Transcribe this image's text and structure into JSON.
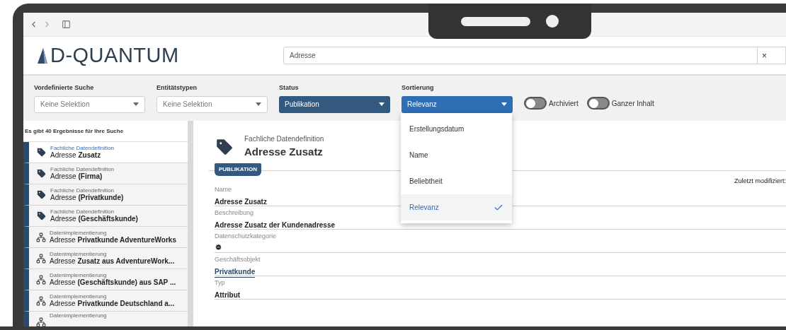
{
  "header": {
    "logo": "D-QUANTUM",
    "search": {
      "value": "Adresse"
    },
    "clear": "×"
  },
  "filters": [
    {
      "label": "Vordefinierte Suche",
      "placeholder": "Keine Selektion",
      "kind": "plain"
    },
    {
      "label": "Entitätstypen",
      "placeholder": "Keine Selektion",
      "kind": "plain"
    },
    {
      "label": "Status",
      "value": "Publikation",
      "kind": "filled"
    },
    {
      "label": "Sortierung",
      "value": "Relevanz",
      "kind": "open"
    }
  ],
  "toggles": [
    {
      "label": "Archiviert",
      "on": false
    },
    {
      "label": "Ganzer Inhalt",
      "on": false
    }
  ],
  "sort_menu": [
    {
      "label": "Erstellungsdatum",
      "selected": false
    },
    {
      "label": "Name",
      "selected": false
    },
    {
      "label": "Beliebtheit",
      "selected": false
    },
    {
      "label": "Relevanz",
      "selected": true
    }
  ],
  "results": {
    "summary": "Es gibt 40 Ergebnisse für Ihre Suche",
    "items": [
      {
        "type": "Fachliche Datendefinition",
        "kind": "definition",
        "title": "Adresse **Zusatz**",
        "selected": true
      },
      {
        "type": "Fachliche Datendefinition",
        "kind": "definition",
        "title": "Adresse **(Firma)**",
        "selected": false
      },
      {
        "type": "Fachliche Datendefinition",
        "kind": "definition",
        "title": "Adresse **(Privatkunde)**",
        "selected": false
      },
      {
        "type": "Fachliche Datendefinition",
        "kind": "definition",
        "title": "Adresse **(Geschäftskunde)**",
        "selected": false
      },
      {
        "type": "Datenimplementierung",
        "kind": "implementation",
        "title": "Adresse **Privatkunde AdventureWorks**",
        "selected": false
      },
      {
        "type": "Datenimplementierung",
        "kind": "implementation",
        "title": "Adresse **Zusatz aus AdventureWork...**",
        "selected": false
      },
      {
        "type": "Datenimplementierung",
        "kind": "implementation",
        "title": "Adresse **(Geschäftskunde) aus SAP ...**",
        "selected": false
      },
      {
        "type": "Datenimplementierung",
        "kind": "implementation",
        "title": "Adresse **Privatkunde Deutschland a...**",
        "selected": false
      },
      {
        "type": "Datenimplementierung",
        "kind": "implementation",
        "selected": false
      }
    ]
  },
  "detail": {
    "type": "Fachliche Datendefinition",
    "title": "Adresse Zusatz",
    "badge": "PUBLIKATION",
    "modified": "Zuletzt modifiziert:",
    "fields": [
      {
        "label": "Name",
        "kind": "text",
        "value": "Adresse Zusatz"
      },
      {
        "label": "Beschreibung",
        "kind": "text",
        "value": "Adresse Zusatz der Kundenadresse"
      },
      {
        "label": "Datenschutzkategorie",
        "kind": "icon"
      },
      {
        "label": "Geschäftsobjekt",
        "kind": "link",
        "value": "Privatkunde"
      },
      {
        "label": "Typ",
        "kind": "text",
        "value": "Attribut"
      }
    ]
  }
}
